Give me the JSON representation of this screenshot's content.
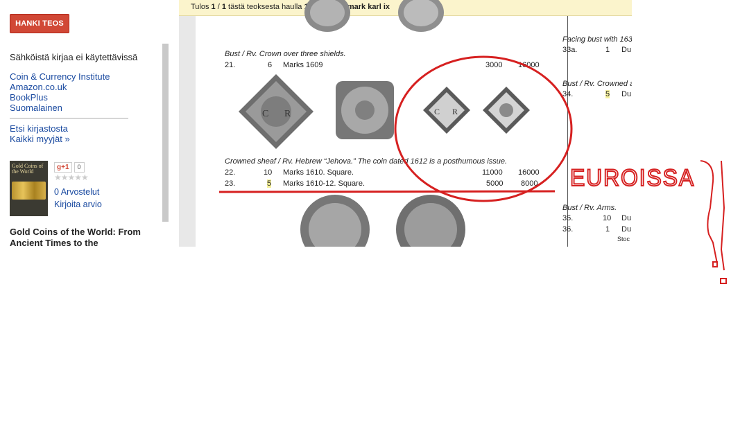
{
  "sidebar": {
    "buy_button": "HANKI TEOS",
    "no_ebook": "Sähköistä kirjaa ei käytettävissä",
    "sellers": [
      "Coin & Currency Institute",
      "Amazon.co.uk",
      "BookPlus",
      "Suomalainen"
    ],
    "find_library": "Etsi kirjastosta",
    "all_sellers": "Kaikki myyjät »",
    "cover_title": "Gold Coins of the World",
    "gplus_label": "g+1",
    "gplus_count": "0",
    "reviews": "0 Arvostelut",
    "write_review": "Kirjoita arvio",
    "book_title": "Gold Coins of the World: From Ancient Times to the"
  },
  "banner": {
    "prefix": "Tulos ",
    "current": "1",
    "sep": " / ",
    "total": "1",
    "middle": " tästä teoksesta haulla ",
    "query": "1611 gold 5 mark karl ix"
  },
  "page": {
    "heading1": "Bust / Rv. Crown over three shields.",
    "row21": {
      "num": "21.",
      "qty": "6",
      "desc": "Marks 1609",
      "v1": "3000",
      "v2": "16000"
    },
    "heading2": "Crowned sheaf / Rv. Hebrew “Jehova.” The coin dated 1612 is a posthumous issue.",
    "row22": {
      "num": "22.",
      "qty": "10",
      "desc": "Marks 1610. Square.",
      "v1": "11000",
      "v2": "16000"
    },
    "row23": {
      "num": "23.",
      "qty": "5",
      "desc": "Marks 1610-12. Square.",
      "v1": "5000",
      "v2": "8000"
    },
    "right_heading1": "Facing bust with 163",
    "right_row33a": {
      "num": "33a.",
      "qty": "1",
      "desc": "Du"
    },
    "right_heading2": "Bust / Rv. Crowned a",
    "right_row34": {
      "num": "34.",
      "qty": "5",
      "desc": "Du"
    },
    "right_heading3": "Bust / Rv. Arms.",
    "right_row35": {
      "num": "35.",
      "qty": "10",
      "desc": "Du"
    },
    "right_row36": {
      "num": "36.",
      "qty": "1",
      "desc": "Du"
    },
    "right_stoc": "Stoc"
  },
  "annotation": {
    "text": "EUROISSA",
    "color": "#d62020"
  }
}
